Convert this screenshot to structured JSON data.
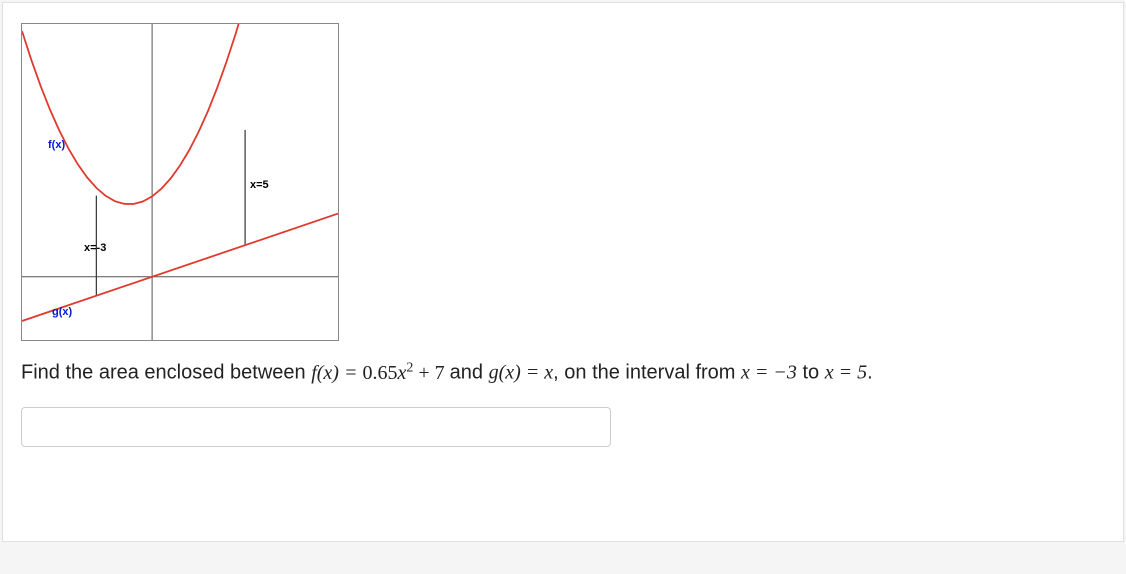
{
  "chart_data": {
    "type": "line",
    "series": [
      {
        "name": "f(x)",
        "formula": "0.65*x^2 + 7",
        "color": "#e03a2f"
      },
      {
        "name": "g(x)",
        "formula": "x",
        "color": "#e03a2f"
      }
    ],
    "vlines": [
      {
        "x": -3,
        "label": "x=-3"
      },
      {
        "x": 5,
        "label": "x=5"
      }
    ],
    "x_range": [
      -7,
      10
    ],
    "y_range": [
      -10,
      40
    ],
    "labels": {
      "f": "f(x)",
      "g": "g(x)",
      "xneg3": "x=-3",
      "x5": "x=5"
    }
  },
  "question": {
    "prefix": "Find the area enclosed between ",
    "f_lhs": "f(x) = ",
    "f_rhs_coef": "0.65",
    "f_rhs_var": "x",
    "f_rhs_exp": "2",
    "f_rhs_tail": " + 7",
    "mid1": " and ",
    "g_lhs": "g(x) = ",
    "g_rhs": "x",
    "mid2": ", on the interval from ",
    "interval_from": "x = −3",
    "mid3": " to ",
    "interval_to": "x = 5",
    "end": "."
  },
  "answer": {
    "value": "",
    "placeholder": ""
  }
}
